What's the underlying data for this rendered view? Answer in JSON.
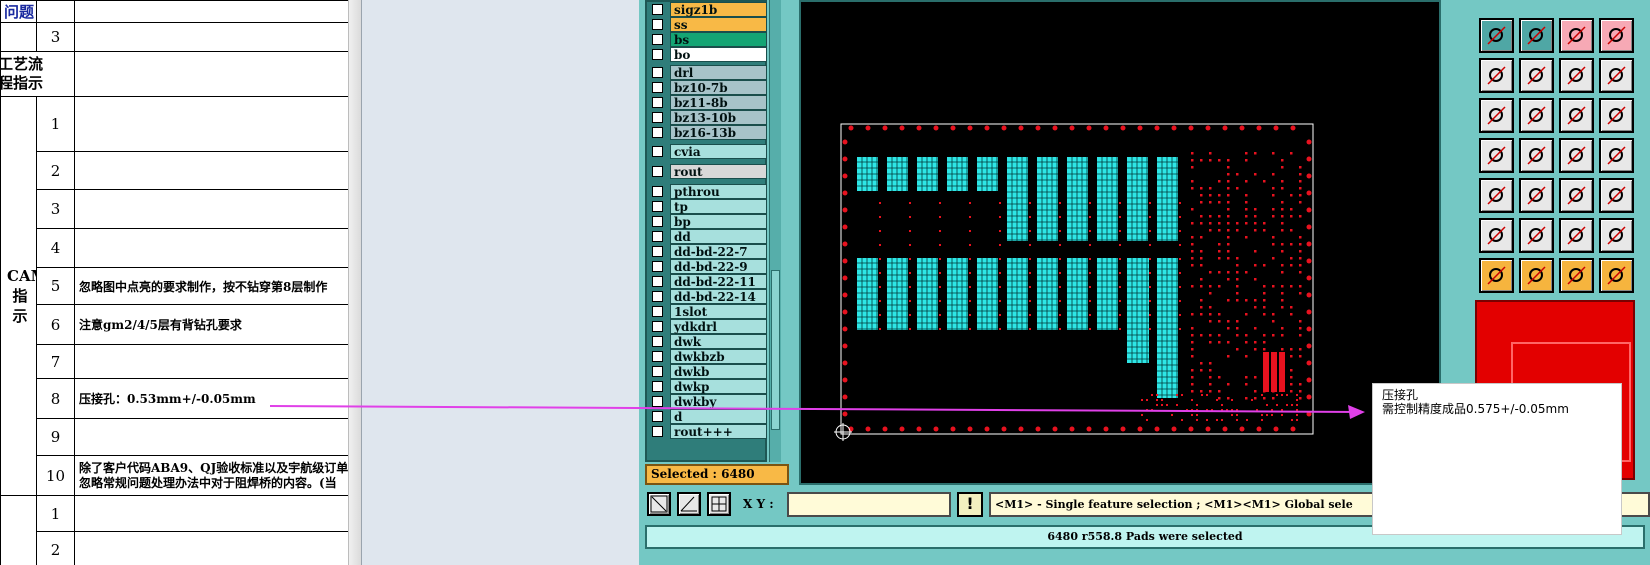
{
  "sheet": {
    "title_partial": "问题",
    "process_label": "工艺流程指示",
    "group_label": "CAM指示",
    "rows": [
      {
        "num": "3",
        "text": ""
      },
      {
        "num": "1",
        "text": ""
      },
      {
        "num": "2",
        "text": ""
      },
      {
        "num": "3",
        "text": ""
      },
      {
        "num": "4",
        "text": ""
      },
      {
        "num": "5",
        "text": "忽略图中点亮的要求制作，按不钻穿第8层制作"
      },
      {
        "num": "6",
        "text": "注意gm2/4/5层有背钻孔要求"
      },
      {
        "num": "7",
        "text": ""
      },
      {
        "num": "8",
        "text": "压接孔：0.53mm+/-0.05mm"
      },
      {
        "num": "9",
        "text": ""
      },
      {
        "num": "10",
        "text": "除了客户代码ABA9、QJ验收标准以及宇航级订单",
        "text2": "忽略常规问题处理办法中对于阻焊桥的内容。(当"
      },
      {
        "num": "1",
        "text": ""
      },
      {
        "num": "2",
        "text": ""
      }
    ]
  },
  "layers": [
    {
      "name": "sigz1b",
      "color": "#f8b946"
    },
    {
      "name": "ss",
      "color": "#f8b946"
    },
    {
      "name": "bs",
      "color": "#14a574"
    },
    {
      "name": "bo",
      "color": "#ffffff"
    },
    {
      "name": "drl",
      "color": "#a7c3c9"
    },
    {
      "name": "bz10-7b",
      "color": "#a7c3c9"
    },
    {
      "name": "bz11-8b",
      "color": "#a7c3c9"
    },
    {
      "name": "bz13-10b",
      "color": "#a7c3c9"
    },
    {
      "name": "bz16-13b",
      "color": "#a7c3c9"
    },
    {
      "name": "cvia",
      "color": "#a7e0dd"
    },
    {
      "name": "rout",
      "color": "#d8d8d8"
    },
    {
      "name": "pthrou",
      "color": "#a7e0dd"
    },
    {
      "name": "tp",
      "color": "#a7e0dd"
    },
    {
      "name": "bp",
      "color": "#a7e0dd"
    },
    {
      "name": "dd",
      "color": "#a7e0dd"
    },
    {
      "name": "dd-bd-22-7",
      "color": "#a7e0dd"
    },
    {
      "name": "dd-bd-22-9",
      "color": "#a7e0dd"
    },
    {
      "name": "dd-bd-22-11",
      "color": "#a7e0dd"
    },
    {
      "name": "dd-bd-22-14",
      "color": "#a7e0dd"
    },
    {
      "name": "1slot",
      "color": "#a7e0dd"
    },
    {
      "name": "ydkdrl",
      "color": "#a7e0dd"
    },
    {
      "name": "dwk",
      "color": "#a7e0dd"
    },
    {
      "name": "dwkbzb",
      "color": "#a7e0dd"
    },
    {
      "name": "dwkb",
      "color": "#a7e0dd"
    },
    {
      "name": "dwkp",
      "color": "#a7e0dd"
    },
    {
      "name": "dwkby",
      "color": "#a7e0dd"
    },
    {
      "name": "d",
      "color": "#a7e0dd"
    },
    {
      "name": "rout+++",
      "color": "#a7e0dd"
    }
  ],
  "selected_label": "Selected : 6480",
  "xy_label": "X Y :",
  "xy_value": "",
  "warn_label": "!",
  "hint_text": "<M1> - Single feature selection ; <M1><M1> Global sele",
  "status_text": "6480 r558.8 Pads were selected",
  "annotation": {
    "title": "压接孔",
    "body": "需控制精度成品0.575+/-0.05mm"
  },
  "colors": {
    "canvas_bg": "#000000",
    "pad_cyan": "#2ee6e6",
    "pad_red": "#e8121f",
    "arrow": "#e040e8",
    "cad_teal": "#74c8c4"
  }
}
